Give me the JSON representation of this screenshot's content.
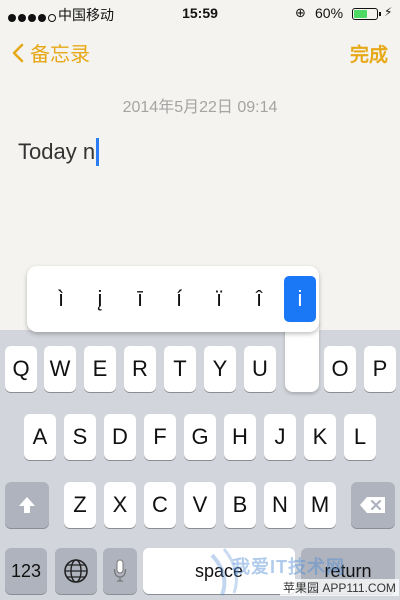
{
  "status_bar": {
    "carrier": "中国移动",
    "time": "15:59",
    "battery_percent": "60%",
    "battery_level": 0.6,
    "signal_bars": 4,
    "rotation_icon": "rotation-lock-icon",
    "charging_icon": "bolt-icon"
  },
  "nav": {
    "back_label": "备忘录",
    "done_label": "完成",
    "accent_color": "#e6a817"
  },
  "note": {
    "date": "2014年5月22日 09:14",
    "text": "Today n"
  },
  "accent_popup": {
    "options": [
      "ì",
      "į",
      "ī",
      "í",
      "ï",
      "î",
      "i"
    ],
    "selected_index": 6
  },
  "keyboard": {
    "row1": [
      "Q",
      "W",
      "E",
      "R",
      "T",
      "Y",
      "U",
      "",
      "O",
      "P"
    ],
    "row2": [
      "A",
      "S",
      "D",
      "F",
      "G",
      "H",
      "J",
      "K",
      "L"
    ],
    "row3": [
      "Z",
      "X",
      "C",
      "V",
      "B",
      "N",
      "M"
    ],
    "numbers_label": "123",
    "space_label": "space",
    "return_label": "return",
    "shift_icon": "shift-icon",
    "delete_icon": "delete-icon",
    "globe_icon": "globe-icon",
    "mic_icon": "microphone-icon"
  },
  "watermark": {
    "text": "我爱IT技术网",
    "sub": "苹果园 APP111.COM"
  }
}
